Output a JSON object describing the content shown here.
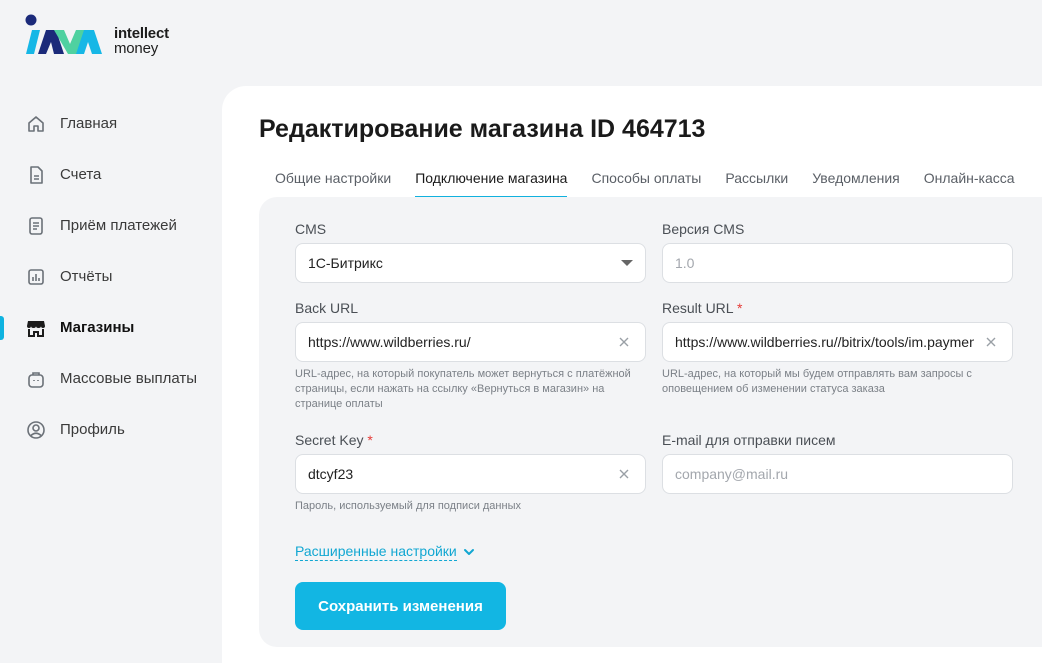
{
  "brand": {
    "line1": "intellect",
    "line2": "money"
  },
  "sidebar": {
    "items": [
      {
        "label": "Главная",
        "icon": "home-icon"
      },
      {
        "label": "Счета",
        "icon": "document-icon"
      },
      {
        "label": "Приём платежей",
        "icon": "receipt-icon"
      },
      {
        "label": "Отчёты",
        "icon": "chart-icon"
      },
      {
        "label": "Магазины",
        "icon": "store-icon",
        "active": true
      },
      {
        "label": "Массовые выплаты",
        "icon": "bag-icon"
      },
      {
        "label": "Профиль",
        "icon": "user-icon"
      }
    ]
  },
  "page": {
    "title": "Редактирование магазина ID 464713"
  },
  "tabs": [
    {
      "label": "Общие настройки"
    },
    {
      "label": "Подключение магазина",
      "active": true
    },
    {
      "label": "Способы оплаты"
    },
    {
      "label": "Рассылки"
    },
    {
      "label": "Уведомления"
    },
    {
      "label": "Онлайн-касса"
    }
  ],
  "form": {
    "cms": {
      "label": "CMS",
      "value": "1С-Битрикс"
    },
    "cms_version": {
      "label": "Версия CMS",
      "placeholder": "1.0"
    },
    "back_url": {
      "label": "Back URL",
      "value": "https://www.wildberries.ru/",
      "hint": "URL-адрес, на который покупатель может вернуться с платёжной страницы, если нажать на ссылку «Вернуться в магазин» на странице оплаты"
    },
    "result_url": {
      "label": "Result URL",
      "required": "*",
      "value": "https://www.wildberries.ru//bitrix/tools/im.payment",
      "hint": "URL-адрес, на который мы будем отправлять вам запросы с оповещением об изменении статуса заказа"
    },
    "secret_key": {
      "label": "Secret Key",
      "required": "*",
      "value": "dtcyf23",
      "hint": "Пароль, используемый для подписи данных"
    },
    "email": {
      "label": "E-mail для отправки писем",
      "placeholder": "company@mail.ru"
    },
    "advanced_label": "Расширенные настройки",
    "save_label": "Сохранить изменения"
  },
  "colors": {
    "accent": "#12b6e3",
    "required": "#e53935",
    "panel": "#f3f4f6"
  }
}
